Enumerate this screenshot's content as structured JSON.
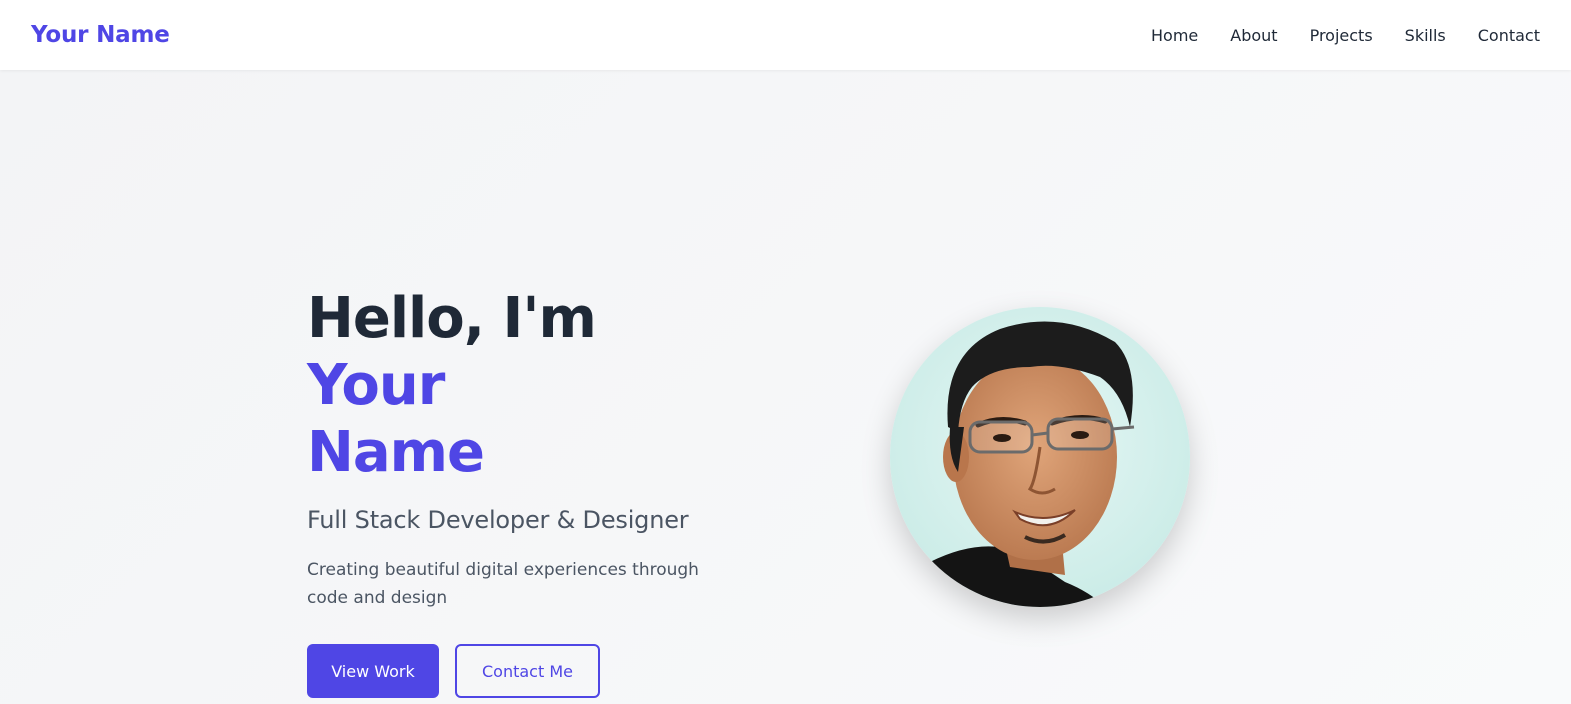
{
  "nav": {
    "brand": "Your Name",
    "links": [
      "Home",
      "About",
      "Projects",
      "Skills",
      "Contact"
    ]
  },
  "hero": {
    "title_prefix": "Hello, I'm ",
    "title_highlight_1": "Your",
    "title_highlight_2": "Name",
    "subtitle": "Full Stack Developer & Designer",
    "description": "Creating beautiful digital experiences through code and design",
    "primary_button": "View Work",
    "secondary_button": "Contact Me"
  },
  "colors": {
    "accent": "#4f46e5",
    "text_dark": "#1f2937",
    "text_muted": "#4b5563"
  }
}
